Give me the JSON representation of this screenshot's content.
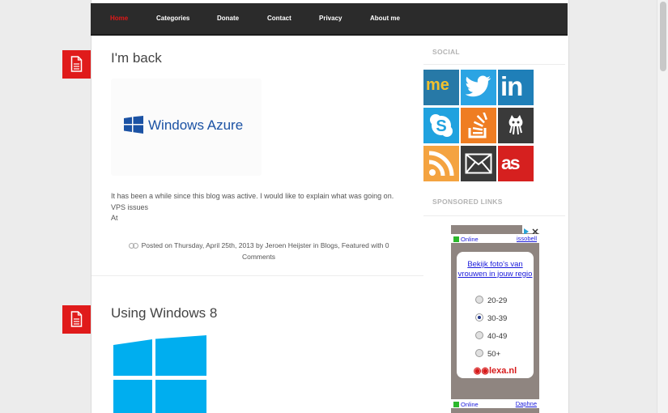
{
  "nav": {
    "items": [
      {
        "label": "Home",
        "active": true
      },
      {
        "label": "Categories"
      },
      {
        "label": "Donate"
      },
      {
        "label": "Contact"
      },
      {
        "label": "Privacy"
      },
      {
        "label": "About me"
      }
    ]
  },
  "posts": [
    {
      "title": "I'm back",
      "image_text": "Windows Azure",
      "excerpt_lines": [
        "It has been a while since this blog was active. I would like to explain what was going on.",
        "VPS issues",
        "At"
      ],
      "meta_line1": "Posted on Thursday, April 25th, 2013 by Jeroen Heijster in Blogs, Featured with 0",
      "meta_line2": "Comments"
    },
    {
      "title": "Using Windows 8"
    }
  ],
  "sidebar": {
    "social_title": "SOCIAL",
    "social_icons": [
      {
        "name": "aboutme-icon",
        "label": "me",
        "color": "#2779a7"
      },
      {
        "name": "twitter-icon",
        "color": "#2ba4e3"
      },
      {
        "name": "linkedin-icon",
        "color": "#1f7fb8"
      },
      {
        "name": "skype-icon",
        "color": "#20a2df"
      },
      {
        "name": "stackoverflow-icon",
        "color": "#ef7d22"
      },
      {
        "name": "github-icon",
        "color": "#3a3a3a"
      },
      {
        "name": "rss-icon",
        "color": "#f4a340"
      },
      {
        "name": "email-icon",
        "color": "#3a3a3a"
      },
      {
        "name": "lastfm-icon",
        "color": "#d6201f"
      }
    ],
    "sponsored_title": "SPONSORED LINKS"
  },
  "ad": {
    "status_top": "Online",
    "user_top": "issobell",
    "headline": "Bekijk foto's van vrouwen in jouw regio",
    "options": [
      {
        "label": "20-29",
        "selected": false
      },
      {
        "label": "30-39",
        "selected": true
      },
      {
        "label": "40-49",
        "selected": false
      },
      {
        "label": "50+",
        "selected": false
      }
    ],
    "brand": "lexa.nl",
    "status_bottom": "Online",
    "user_bottom": "Daphne"
  },
  "colors": {
    "accent": "#e01b1b",
    "nav_bg": "#2b2b2b",
    "azure_blue": "#1b52a4",
    "win8_blue": "#00aeef"
  }
}
